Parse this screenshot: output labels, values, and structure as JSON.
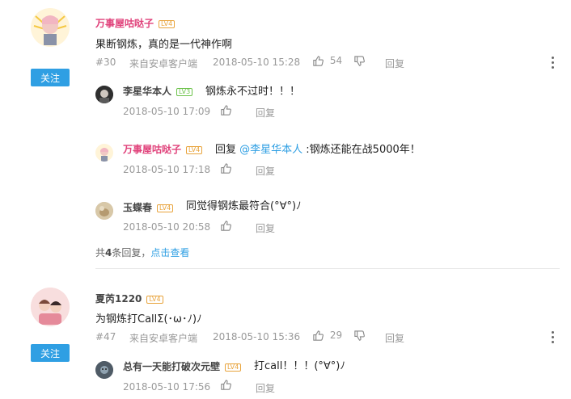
{
  "comments": [
    {
      "username": "万事屋咕哒子",
      "level": "LV4",
      "text": "果断钢炼，真的是一代神作啊",
      "floor": "#30",
      "source": "来自安卓客户端",
      "time": "2018-05-10 15:28",
      "likes": "54",
      "reply_label": "回复",
      "follow_label": "关注",
      "replies": [
        {
          "username": "李星华本人",
          "level": "LV3",
          "text": "钢炼永不过时！！！",
          "time": "2018-05-10 17:09",
          "reply_label": "回复"
        },
        {
          "username": "万事屋咕哒子",
          "level": "LV4",
          "prefix": "回复 ",
          "mention": "@李星华本人",
          "text": " :钢炼还能在战5000年！",
          "time": "2018-05-10 17:18",
          "reply_label": "回复"
        },
        {
          "username": "玉蝶春",
          "level": "LV4",
          "text": "同觉得钢炼最符合(°∀°)ﾉ",
          "time": "2018-05-10 20:58",
          "reply_label": "回复"
        }
      ],
      "summary_prefix": "共",
      "summary_count": "4",
      "summary_suffix": "条回复，",
      "summary_link": "点击查看"
    },
    {
      "username": "夏芮1220",
      "level": "LV4",
      "text": "为钢炼打CallΣ(･ω･ﾉ)ﾉ",
      "floor": "#47",
      "source": "来自安卓客户端",
      "time": "2018-05-10 15:36",
      "likes": "29",
      "reply_label": "回复",
      "follow_label": "关注",
      "replies": [
        {
          "username": "总有一天能打破次元壁",
          "level": "LV4",
          "text": "打call！！！(°∀°)ﾉ",
          "time": "2018-05-10 17:56",
          "reply_label": "回复"
        }
      ]
    }
  ],
  "icons": {
    "like": "thumbs-up-icon",
    "dislike": "thumbs-down-icon",
    "more": "more-vertical-icon"
  },
  "colors": {
    "accent": "#2f9fe3",
    "name_pink": "#e0417a",
    "meta_gray": "#999999",
    "level_orange": "#e8a33b",
    "level_green": "#6cc24a"
  }
}
